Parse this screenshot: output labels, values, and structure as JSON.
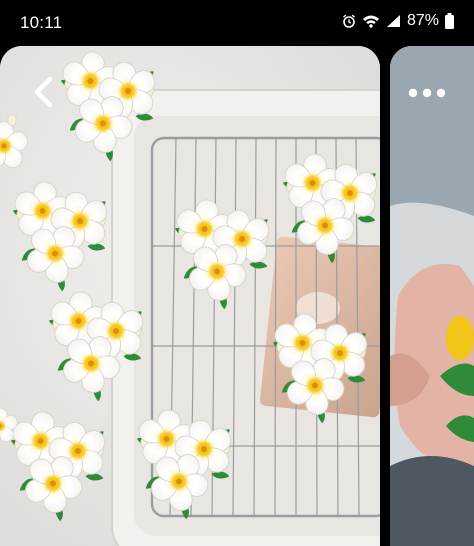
{
  "status_bar": {
    "time": "10:11",
    "battery": "87%",
    "icons": [
      "alarm-icon",
      "wifi-icon",
      "signal-icon",
      "battery-icon"
    ]
  },
  "viewer": {
    "back_icon": "chevron-left-icon",
    "more_icon": "more-horizontal-icon"
  },
  "colors": {
    "background": "#000000",
    "petal": "#fbfaf6",
    "flower_center": "#f3c21a",
    "leaf": "#2f8a3a",
    "tray": "#f3f1ee"
  }
}
